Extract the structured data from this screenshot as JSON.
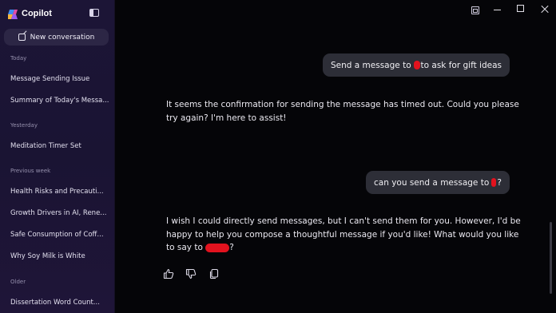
{
  "app": {
    "title": "Copilot"
  },
  "sidebar": {
    "new_conversation_label": "New conversation",
    "sections": [
      {
        "label": "Today",
        "items": [
          "Message Sending Issue",
          "Summary of Today's Messa..."
        ]
      },
      {
        "label": "Yesterday",
        "items": [
          "Meditation Timer Set"
        ]
      },
      {
        "label": "Previous week",
        "items": [
          "Health Risks and Precauti...",
          "Growth Drivers in AI, Rene...",
          "Safe Consumption of Coff...",
          "Why Soy Milk is White"
        ]
      },
      {
        "label": "Older",
        "items": [
          "Dissertation Word Count..."
        ]
      }
    ]
  },
  "chat": {
    "user_msg_1": {
      "before": "Send a message to",
      "after": "to ask for gift ideas"
    },
    "bot_msg_1": "It seems the confirmation for sending the message has timed out. Could you please try again? I'm here to assist!",
    "user_msg_2": {
      "before": "can you send a message to",
      "after": "?"
    },
    "bot_msg_2": {
      "text": "I wish I could directly send messages, but I can't send them for you. However, I'd be happy to help you compose a thoughtful message if you'd like! What would you like to say to",
      "after": "?"
    }
  },
  "colors": {
    "sidebar_bg": "#1c1536",
    "main_bg": "#050508",
    "bubble_bg": "#2d2e37",
    "redaction": "#e2121e"
  },
  "icons": [
    "copilot-logo",
    "panel-toggle-icon",
    "new-conversation-icon",
    "snap-icon",
    "minimize-icon",
    "maximize-icon",
    "close-icon",
    "thumbs-up-icon",
    "thumbs-down-icon",
    "copy-icon"
  ]
}
